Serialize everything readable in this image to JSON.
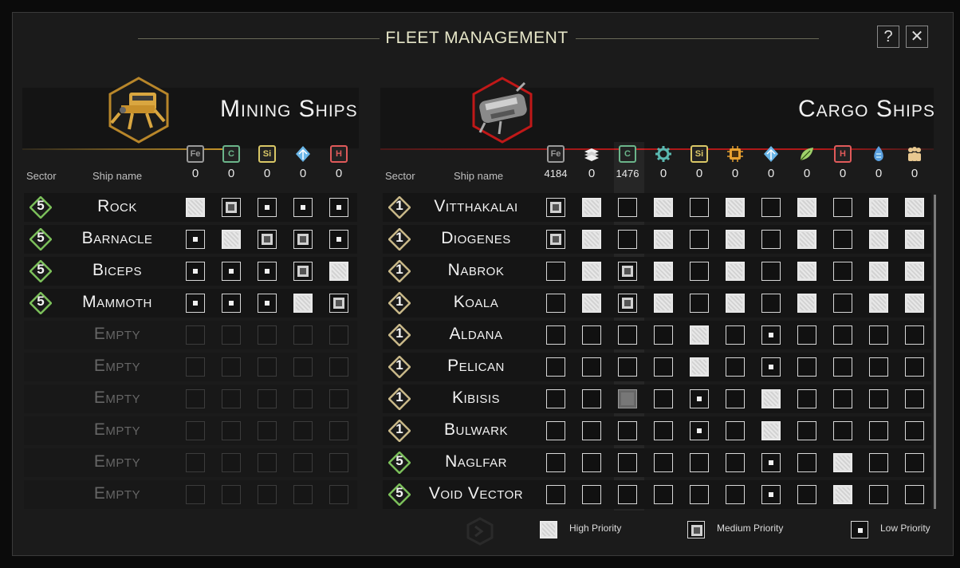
{
  "title": "FLEET MANAGEMENT",
  "help_label": "?",
  "close_label": "✕",
  "mining": {
    "title": "Mining Ships",
    "col_sector": "Sector",
    "col_ship": "Ship name",
    "resources": [
      {
        "label": "Fe",
        "count": "0",
        "color": "#9a9a9a"
      },
      {
        "label": "C",
        "count": "0",
        "color": "#6bb58a"
      },
      {
        "label": "Si",
        "count": "0",
        "color": "#d9c766"
      },
      {
        "label": "ice-icon",
        "count": "0",
        "color": "#6ab6e8"
      },
      {
        "label": "H",
        "count": "0",
        "color": "#e05a5a"
      }
    ],
    "ships": [
      {
        "sector": "5",
        "name": "Rock",
        "priorities": [
          "high",
          "med",
          "low",
          "low",
          "low"
        ]
      },
      {
        "sector": "5",
        "name": "Barnacle",
        "priorities": [
          "low",
          "high",
          "med",
          "med",
          "low"
        ]
      },
      {
        "sector": "5",
        "name": "Biceps",
        "priorities": [
          "low",
          "low",
          "low",
          "med",
          "high"
        ]
      },
      {
        "sector": "5",
        "name": "Mammoth",
        "priorities": [
          "low",
          "low",
          "low",
          "high",
          "med"
        ]
      },
      {
        "sector": "",
        "name": "Empty",
        "priorities": [
          "none",
          "none",
          "none",
          "none",
          "none"
        ]
      },
      {
        "sector": "",
        "name": "Empty",
        "priorities": [
          "none",
          "none",
          "none",
          "none",
          "none"
        ]
      },
      {
        "sector": "",
        "name": "Empty",
        "priorities": [
          "none",
          "none",
          "none",
          "none",
          "none"
        ]
      },
      {
        "sector": "",
        "name": "Empty",
        "priorities": [
          "none",
          "none",
          "none",
          "none",
          "none"
        ]
      },
      {
        "sector": "",
        "name": "Empty",
        "priorities": [
          "none",
          "none",
          "none",
          "none",
          "none"
        ]
      },
      {
        "sector": "",
        "name": "Empty",
        "priorities": [
          "none",
          "none",
          "none",
          "none",
          "none"
        ]
      }
    ]
  },
  "cargo": {
    "title": "Cargo Ships",
    "col_sector": "Sector",
    "col_ship": "Ship name",
    "resources": [
      {
        "label": "Fe",
        "count": "4184",
        "color": "#9a9a9a"
      },
      {
        "label": "plates-icon",
        "count": "0",
        "color": "#e8e8e8"
      },
      {
        "label": "C",
        "count": "1476",
        "color": "#6bb58a"
      },
      {
        "label": "gear-icon",
        "count": "0",
        "color": "#5ab8b0"
      },
      {
        "label": "Si",
        "count": "0",
        "color": "#d9c766"
      },
      {
        "label": "chip-icon",
        "count": "0",
        "color": "#e8a030"
      },
      {
        "label": "ice-icon",
        "count": "0",
        "color": "#6ab6e8"
      },
      {
        "label": "leaf-icon",
        "count": "0",
        "color": "#9ed06a"
      },
      {
        "label": "H",
        "count": "0",
        "color": "#e05a5a"
      },
      {
        "label": "droplet-icon",
        "count": "0",
        "color": "#5aa0e0"
      },
      {
        "label": "people-icon",
        "count": "0",
        "color": "#e8c890"
      }
    ],
    "ships": [
      {
        "sector": "1",
        "name": "Vitthakalai",
        "priorities": [
          "med",
          "high",
          "none",
          "high",
          "none",
          "high",
          "none",
          "high",
          "none",
          "high",
          "high"
        ]
      },
      {
        "sector": "1",
        "name": "Diogenes",
        "priorities": [
          "med",
          "high",
          "none",
          "high",
          "none",
          "high",
          "none",
          "high",
          "none",
          "high",
          "high"
        ]
      },
      {
        "sector": "1",
        "name": "Nabrok",
        "priorities": [
          "none",
          "high",
          "med",
          "high",
          "none",
          "high",
          "none",
          "high",
          "none",
          "high",
          "high"
        ]
      },
      {
        "sector": "1",
        "name": "Koala",
        "priorities": [
          "none",
          "high",
          "med",
          "high",
          "none",
          "high",
          "none",
          "high",
          "none",
          "high",
          "high"
        ]
      },
      {
        "sector": "1",
        "name": "Aldana",
        "priorities": [
          "none",
          "none",
          "none",
          "none",
          "high",
          "none",
          "low",
          "none",
          "none",
          "none",
          "none"
        ]
      },
      {
        "sector": "1",
        "name": "Pelican",
        "priorities": [
          "none",
          "none",
          "none",
          "none",
          "high",
          "none",
          "low",
          "none",
          "none",
          "none",
          "none"
        ]
      },
      {
        "sector": "1",
        "name": "Kibisis",
        "priorities": [
          "none",
          "none",
          "gray",
          "none",
          "low",
          "none",
          "high",
          "none",
          "none",
          "none",
          "none"
        ]
      },
      {
        "sector": "1",
        "name": "Bulwark",
        "priorities": [
          "none",
          "none",
          "none",
          "none",
          "low",
          "none",
          "high",
          "none",
          "none",
          "none",
          "none"
        ]
      },
      {
        "sector": "5",
        "name": "Naglfar",
        "priorities": [
          "none",
          "none",
          "none",
          "none",
          "none",
          "none",
          "low",
          "none",
          "high",
          "none",
          "none"
        ]
      },
      {
        "sector": "5",
        "name": "Void Vector",
        "priorities": [
          "none",
          "none",
          "none",
          "none",
          "none",
          "none",
          "low",
          "none",
          "high",
          "none",
          "none"
        ]
      }
    ]
  },
  "legend": {
    "high": "High Priority",
    "medium": "Medium Priority",
    "low": "Low Priority"
  }
}
